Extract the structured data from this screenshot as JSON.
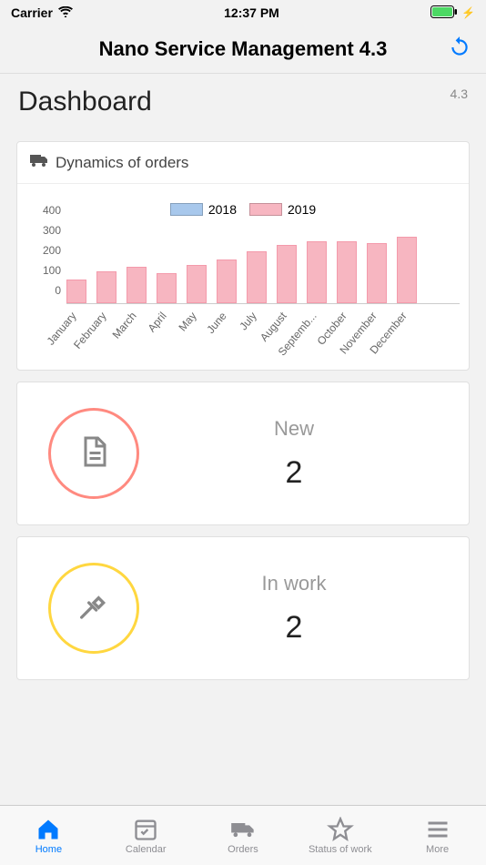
{
  "status": {
    "carrier": "Carrier",
    "time": "12:37 PM"
  },
  "header": {
    "title": "Nano Service Management 4.3"
  },
  "page": {
    "title": "Dashboard",
    "version": "4.3"
  },
  "chart": {
    "title": "Dynamics of orders",
    "legend_2018": "2018",
    "legend_2019": "2019"
  },
  "chart_data": {
    "type": "bar",
    "title": "Dynamics of orders",
    "xlabel": "",
    "ylabel": "",
    "ylim": [
      0,
      400
    ],
    "categories": [
      "January",
      "February",
      "March",
      "April",
      "May",
      "June",
      "July",
      "August",
      "September",
      "October",
      "November",
      "December"
    ],
    "series": [
      {
        "name": "2018",
        "values": [
          null,
          null,
          null,
          null,
          null,
          null,
          null,
          null,
          null,
          null,
          null,
          null
        ]
      },
      {
        "name": "2019",
        "values": [
          120,
          160,
          180,
          150,
          190,
          220,
          260,
          290,
          310,
          310,
          300,
          330
        ]
      }
    ]
  },
  "stats": {
    "new": {
      "label": "New",
      "value": "2",
      "ring": "#ff8a80"
    },
    "inwork": {
      "label": "In work",
      "value": "2",
      "ring": "#ffd740"
    }
  },
  "tabs": {
    "home": "Home",
    "calendar": "Calendar",
    "orders": "Orders",
    "status": "Status of work",
    "more": "More"
  },
  "colors": {
    "s2018": "#a8c8ec",
    "s2019": "#f7b6c1"
  }
}
